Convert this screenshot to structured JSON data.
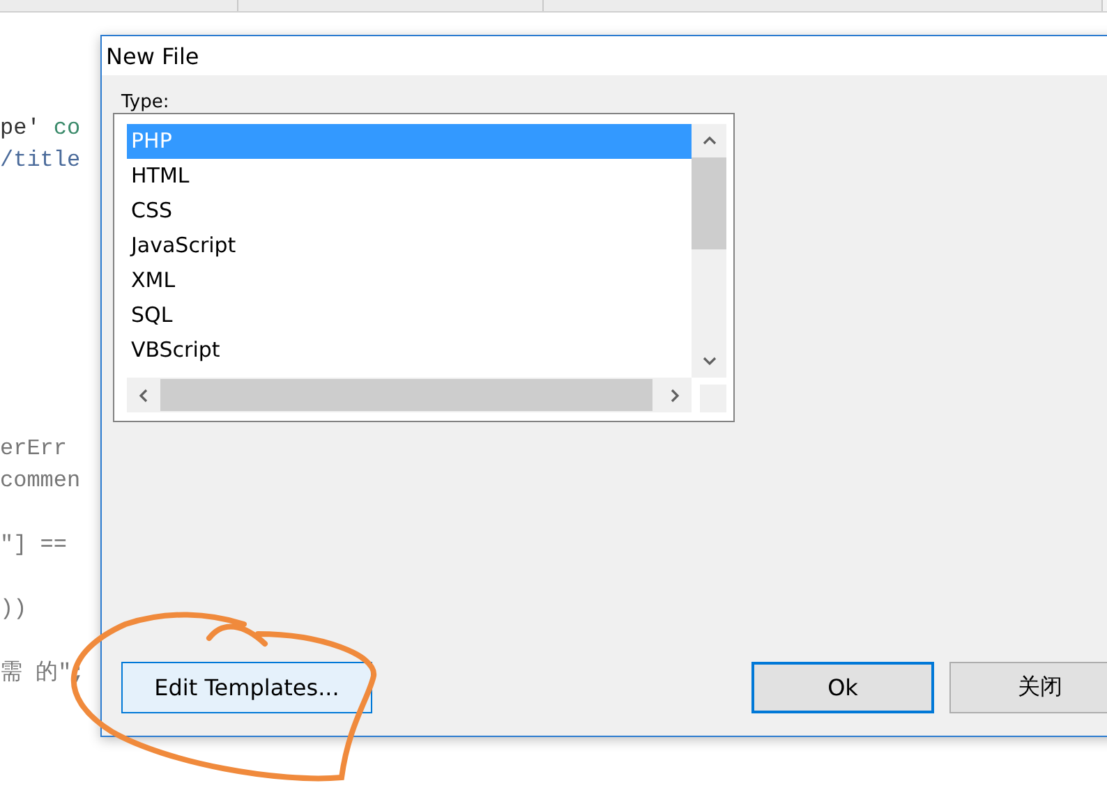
{
  "editor": {
    "code_lines": [
      {
        "segments": [
          {
            "text": "pe' ",
            "kind": "plain"
          },
          {
            "text": "co",
            "kind": "keyword"
          }
        ]
      },
      {
        "segments": [
          {
            "text": "/title",
            "kind": "tag"
          }
        ]
      },
      {
        "segments": [
          {
            "text": "erErr",
            "kind": "muted"
          }
        ]
      },
      {
        "segments": [
          {
            "text": "commen",
            "kind": "muted"
          }
        ]
      },
      {
        "segments": [
          {
            "text": "\"] ==",
            "kind": "muted"
          }
        ]
      },
      {
        "segments": [
          {
            "text": "))",
            "kind": "muted"
          }
        ]
      },
      {
        "segments": [
          {
            "text": "需 的\";",
            "kind": "muted"
          }
        ]
      }
    ]
  },
  "dialog": {
    "title": "New File",
    "type_label": "Type:",
    "types": [
      {
        "label": "PHP",
        "selected": true
      },
      {
        "label": "HTML",
        "selected": false
      },
      {
        "label": "CSS",
        "selected": false
      },
      {
        "label": "JavaScript",
        "selected": false
      },
      {
        "label": "XML",
        "selected": false
      },
      {
        "label": "SQL",
        "selected": false
      },
      {
        "label": "VBScript",
        "selected": false
      }
    ],
    "buttons": [
      {
        "label": "Edit Templates...",
        "kind": "secondary"
      },
      {
        "label": "Ok",
        "kind": "default"
      },
      {
        "label": "关闭",
        "kind": "plain"
      }
    ]
  }
}
